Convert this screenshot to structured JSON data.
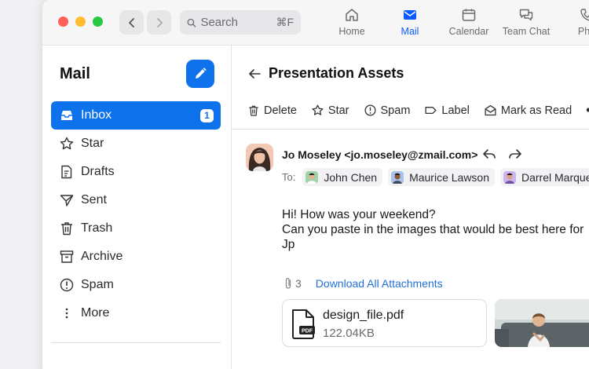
{
  "titlebar": {
    "search": {
      "placeholder": "Search",
      "shortcut": "⌘F"
    },
    "tabs": [
      {
        "label": "Home",
        "icon": "home-icon"
      },
      {
        "label": "Mail",
        "icon": "mail-icon",
        "active": true
      },
      {
        "label": "Calendar",
        "icon": "calendar-icon"
      },
      {
        "label": "Team Chat",
        "icon": "chat-icon"
      },
      {
        "label": "Pho",
        "icon": "phone-icon"
      }
    ]
  },
  "sidebar": {
    "title": "Mail",
    "items": [
      {
        "label": "Inbox",
        "icon": "inbox-icon",
        "badge": "1",
        "active": true
      },
      {
        "label": "Star",
        "icon": "star-icon"
      },
      {
        "label": "Drafts",
        "icon": "drafts-icon"
      },
      {
        "label": "Sent",
        "icon": "sent-icon"
      },
      {
        "label": "Trash",
        "icon": "trash-icon"
      },
      {
        "label": "Archive",
        "icon": "archive-icon"
      },
      {
        "label": "Spam",
        "icon": "spam-icon"
      },
      {
        "label": "More",
        "icon": "more-vertical-icon"
      }
    ]
  },
  "email": {
    "subject": "Presentation Assets",
    "toolbar": {
      "delete": "Delete",
      "star": "Star",
      "spam": "Spam",
      "label": "Label",
      "mark_read": "Mark as Read",
      "more": "•••"
    },
    "from": "Jo Moseley <jo.moseley@zmail.com>",
    "to_label": "To:",
    "recipients": [
      "John Chen",
      "Maurice Lawson",
      "Darrel Marquez"
    ],
    "body": {
      "line1": "Hi! How was your weekend?",
      "line2": "Can you paste in the images that would be best here for",
      "line3": "Jp"
    },
    "attachments": {
      "count": "3",
      "download_all": "Download All Attachments",
      "file": {
        "name": "design_file.pdf",
        "size": "122.04KB",
        "type_label": "PDF"
      }
    }
  },
  "colors": {
    "accent": "#0e72ed",
    "tab_active": "#0b5cff",
    "link": "#1f6fd6",
    "traffic_red": "#fe5f57",
    "traffic_yellow": "#febc2e",
    "traffic_green": "#28c840"
  }
}
